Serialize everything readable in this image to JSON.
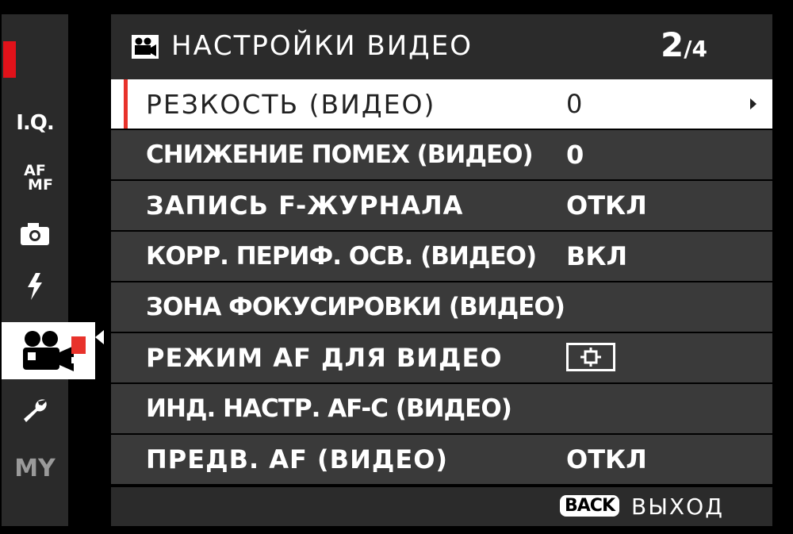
{
  "header": {
    "icon": "movie-camera-icon",
    "title": "НАСТРОЙКИ ВИДЕО",
    "page_current": "2",
    "page_total": "/4"
  },
  "sidebar": {
    "tabs": [
      {
        "name": "image-quality",
        "label": "I.Q."
      },
      {
        "name": "af-mf",
        "label_top": "AF",
        "label_bottom": "MF"
      },
      {
        "name": "shooting",
        "icon": "camera-icon"
      },
      {
        "name": "flash",
        "icon": "lightning-icon"
      },
      {
        "name": "movie",
        "icon": "movie-camera-icon",
        "selected": true
      },
      {
        "name": "setup",
        "icon": "wrench-icon"
      },
      {
        "name": "my-menu",
        "label": "MY"
      }
    ],
    "accent_color": "#e8322b"
  },
  "menu": {
    "items": [
      {
        "label": "РЕЗКОСТЬ (ВИДЕО)",
        "value": "0",
        "selected": true
      },
      {
        "label": "СНИЖЕНИЕ ПОМЕХ (ВИДЕО)",
        "value": "0"
      },
      {
        "label": "ЗАПИСЬ F-ЖУРНАЛА",
        "value": "ОТКЛ"
      },
      {
        "label": "КОРР. ПЕРИФ. ОСВ. (ВИДЕО)",
        "value": "ВКЛ"
      },
      {
        "label": "ЗОНА ФОКУСИРОВКИ (ВИДЕО)",
        "value": ""
      },
      {
        "label": "РЕЖИМ AF ДЛЯ ВИДЕО",
        "value_icon": "af-area-icon"
      },
      {
        "label": "ИНД. НАСТР. AF-C (ВИДЕО)",
        "value": ""
      },
      {
        "label": "ПРЕДВ. AF (ВИДЕО)",
        "value": "ОТКЛ"
      }
    ]
  },
  "footer": {
    "back_badge": "BACK",
    "exit_label": "ВЫХОД"
  }
}
